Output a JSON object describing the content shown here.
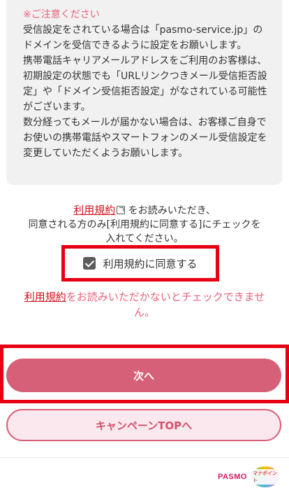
{
  "notice": {
    "title": "※ご注意ください",
    "para1": "受信設定をされている場合は「pasmo-service.jp」のドメインを受信できるように設定をお願いします。",
    "para2": "携帯電話キャリアメールアドレスをご利用のお客様は、初期設定の状態でも「URLリンクつきメール受信拒否設定」や「ドメイン受信拒否設定」がなされている可能性がございます。",
    "para3": "数分経ってもメールが届かない場合は、お客様ご自身でお使いの携帯電話やスマートフォンのメール受信設定を変更していただくようお願いします。"
  },
  "terms": {
    "link_label": "利用規約",
    "line1_suffix": "をお読みいただき、",
    "line2": "同意される方のみ[利用規約に同意する]にチェックを入れてください。"
  },
  "agree": {
    "checkbox_label": "利用規約に同意する",
    "checked": true
  },
  "warning": {
    "link_label": "利用規約",
    "suffix": "をお読みいただかないとチェックできません。"
  },
  "buttons": {
    "next_label": "次へ",
    "campaign_label": "キャンペーンTOPへ"
  },
  "footer": {
    "pasmo_logo_text": "PASMO",
    "point_logo_text": "マナポイント"
  },
  "colors": {
    "accent_pink": "#d66077",
    "warning_red": "#e8637b",
    "highlight_red": "#e60012"
  }
}
